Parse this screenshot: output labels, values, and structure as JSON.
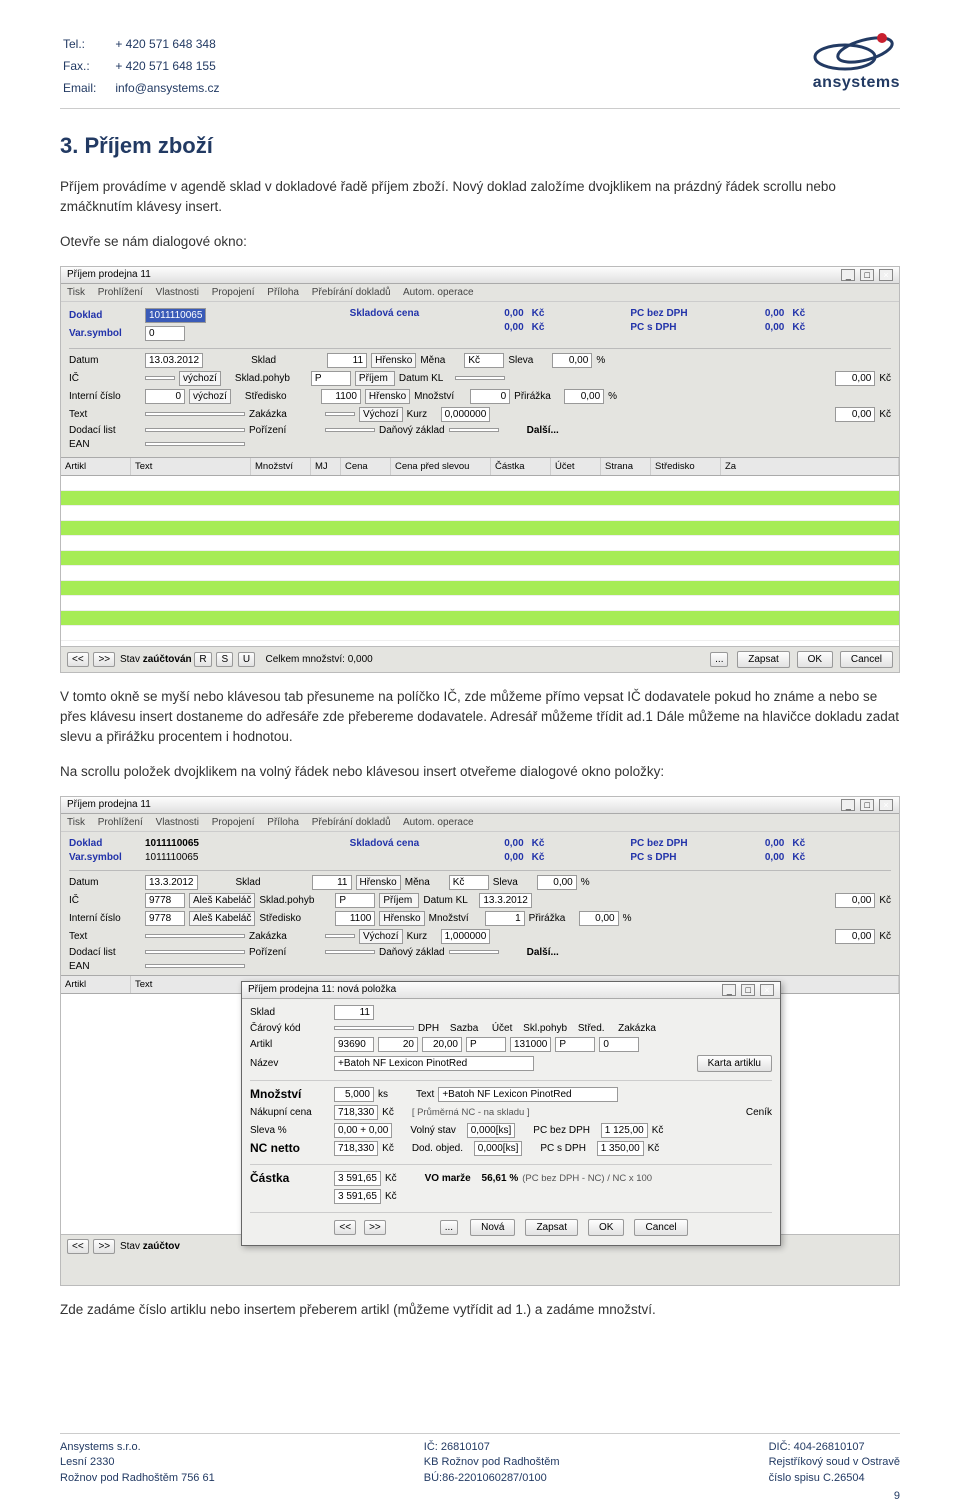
{
  "header": {
    "tel_label": "Tel.:",
    "tel": "+ 420 571 648 348",
    "fax_label": "Fax.:",
    "fax": "+ 420 571 648 155",
    "email_label": "Email:",
    "email": "info@ansystems.cz",
    "brand": "ansystems"
  },
  "section_title": "3. Příjem zboží",
  "para1": "Příjem provádíme v agendě sklad v dokladové řadě příjem zboží. Nový doklad založíme dvojklikem na prázdný řádek scrollu nebo zmáčknutím klávesy insert.",
  "para1b": "Otevře se nám dialogové okno:",
  "shot1": {
    "title": "Příjem prodejna 11",
    "toolbar": [
      "Tisk",
      "Prohlížení",
      "Vlastnosti",
      "Propojení",
      "Příloha",
      "Přebírání dokladů",
      "Autom. operace"
    ],
    "doc": {
      "doklad_label": "Doklad",
      "doklad": "1011110065",
      "skl_cena_label": "Skladová cena",
      "skl_cena": "0,00",
      "kc": "Kč",
      "pc_bez_label": "PC bez DPH",
      "pc_bez": "0,00",
      "var_label": "Var.symbol",
      "var": "0",
      "val2": "0,00",
      "pc_s_label": "PC s DPH",
      "pc_s": "0,00"
    },
    "fields": {
      "datum_l": "Datum",
      "datum": "13.03.2012",
      "sklad_l": "Sklad",
      "sklad": "11",
      "sklad_t": "Hřensko",
      "mena_l": "Měna",
      "mena": "Kč",
      "sleva_l": "Sleva",
      "sleva": "0,00",
      "pct": "%",
      "ic_l": "IČ",
      "vychozi": "výchozí",
      "pohyb_l": "Sklad.pohyb",
      "pohyb": "P",
      "pohyb_t": "Příjem",
      "datkl_l": "Datum KL",
      "datkl_v": "0,00",
      "kc": "Kč",
      "int_l": "Interní číslo",
      "int": "0",
      "stred_l": "Středisko",
      "stred": "1100",
      "stred_t": "Hřensko",
      "mn_l": "Množství",
      "mn": "0",
      "prir_l": "Přirážka",
      "prir": "0,00",
      "text_l": "Text",
      "zak_l": "Zakázka",
      "zak_t": "Výchozí",
      "kurz_l": "Kurz",
      "kurz": "0,000000",
      "prir2": "0,00",
      "dod_l": "Dodací list",
      "por_l": "Pořízení",
      "dz_l": "Daňový základ",
      "dalsi": "Další...",
      "ean_l": "EAN"
    },
    "grid_headers": [
      "Artikl",
      "Text",
      "Množství",
      "MJ",
      "Cena",
      "Cena před slevou",
      "Částka",
      "Účet",
      "Strana",
      "Středisko",
      "Za"
    ],
    "status": {
      "stav_l": "Stav",
      "stav": "zaúčtován",
      "r": "R",
      "s": "S",
      "u": "U",
      "celk": "Celkem množství: 0,000",
      "zapsat": "Zapsat",
      "ok": "OK",
      "cancel": "Cancel"
    }
  },
  "para2": "V tomto okně se myší nebo klávesou tab přesuneme na políčko IČ, zde můžeme přímo vepsat IČ dodavatele pokud ho známe a nebo se přes klávesu insert dostaneme do adřesáře zde přebereme dodavatele. Adresář můžeme třídit ad.1  Dále můžeme na hlavičce dokladu zadat slevu a přirážku procentem i hodnotou.",
  "para3": "Na scrollu položek dvojklikem na volný řádek nebo klávesou insert otveřeme dialogové okno položky:",
  "shot2": {
    "title": "Příjem prodejna 11",
    "doc": {
      "doklad": "1011110065",
      "var": "1011110065",
      "skl_cena": "0,00",
      "pc_bez": "0,00",
      "pc_s": "0,00"
    },
    "fields": {
      "datum": "13.3.2012",
      "sklad": "11",
      "sklad_t": "Hřensko",
      "mena": "Kč",
      "sleva": "0,00",
      "ic": "9778",
      "ic_t": "Aleš Kabeláč",
      "pohyb": "P",
      "pohyb_t": "Příjem",
      "datkl": "13.3.2012",
      "dk_v": "0,00",
      "int": "9778",
      "int_t": "Aleš Kabeláč",
      "stred": "1100",
      "stred_t": "Hřensko",
      "mn": "1",
      "prir": "0,00",
      "kurz": "1,000000",
      "prir2": "0,00"
    },
    "dialog": {
      "title": "Příjem prodejna 11: nová položka",
      "sklad_l": "Sklad",
      "sklad": "11",
      "hdr": [
        "DPH",
        "Sazba",
        "Účet",
        "Skl.pohyb",
        "Střed.",
        "Zakázka"
      ],
      "car_l": "Čárový kód",
      "art_l": "Artikl",
      "art": "93690",
      "dph1": "20",
      "dph2": "20,00",
      "ucet": "P",
      "ucet2": "131000",
      "sp": "P",
      "st": "0",
      "naz_l": "Název",
      "naz": "+Batoh NF Lexicon PinotRed",
      "karta": "Karta artiklu",
      "mn_l": "Množství",
      "mn": "5,000",
      "mj": "ks",
      "text_l": "Text",
      "text": "+Batoh NF Lexicon PinotRed",
      "nc_l": "Nákupní cena",
      "nc": "718,330",
      "kc": "Kč",
      "prum": "[ Průměrná NC - na skladu ]",
      "cenik": "Ceník",
      "sl_l": "Sleva %",
      "sl": "0,00 + 0,00",
      "vs_l": "Volný stav",
      "vs": "0,000[ks]",
      "pcb_l": "PC bez DPH",
      "pcb": "1 125,00",
      "ncn_l": "NC netto",
      "ncn": "718,330",
      "do_l": "Dod. objed.",
      "do": "0,000[ks]",
      "pcs_l": "PC s DPH",
      "pcs": "1 350,00",
      "cast_l": "Částka",
      "cast": "3 591,65",
      "vo_l": "VO marže",
      "vo": "56,61 %",
      "fine": "(PC bez DPH - NC) / NC x 100",
      "cast2": "3 591,65",
      "nova": "Nová",
      "zapsat": "Zapsat",
      "ok": "OK",
      "cancel": "Cancel"
    },
    "status": {
      "stav": "zaúčtov"
    }
  },
  "para4": "Zde zadáme číslo artiklu nebo insertem přeberem artikl (můžeme vytřídit ad 1.) a zadáme množství.",
  "footer": {
    "c1a": "Ansystems s.r.o.",
    "c1b": "Lesní 2330",
    "c1c": "Rožnov pod Radhoštěm 756 61",
    "c2a": "IČ: 26810107",
    "c2b": "KB Rožnov pod Radhoštěm",
    "c2c": "BÚ:86-2201060287/0100",
    "c3a": "DIČ: 404-26810107",
    "c3b": "Rejstříkový soud v Ostravě",
    "c3c": "číslo spisu C.26504",
    "page": "9"
  }
}
